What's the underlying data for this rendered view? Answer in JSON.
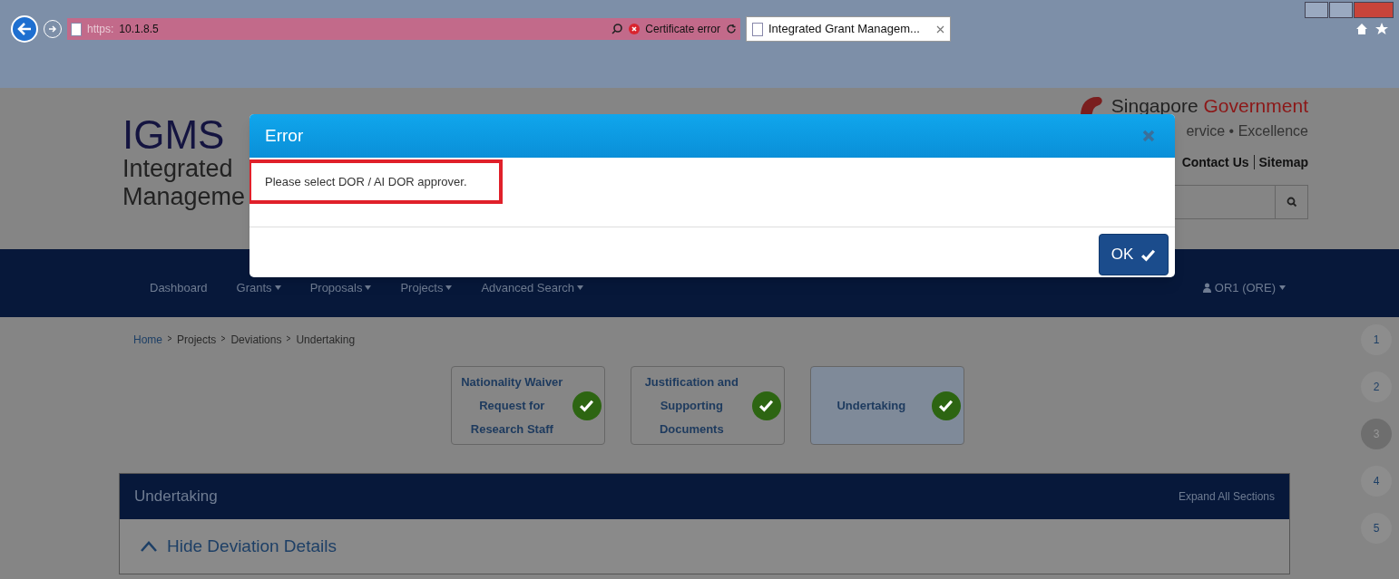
{
  "browser": {
    "url_scheme": "https:",
    "url_host": "10.1.8.5",
    "certificate": "Certificate error",
    "tab_title": "Integrated Grant Managem..."
  },
  "header": {
    "logo": "IGMS",
    "logo_line_1": "Integrated",
    "logo_line_2": "Manageme",
    "gov_1": "Singapore",
    "gov_2": "Government",
    "gov_tagline": "ervice • Excellence",
    "links": [
      "Contact Us",
      "Sitemap"
    ]
  },
  "nav": {
    "items": [
      {
        "label": "Dashboard",
        "dropdown": false
      },
      {
        "label": "Grants",
        "dropdown": true
      },
      {
        "label": "Proposals",
        "dropdown": true
      },
      {
        "label": "Projects",
        "dropdown": true
      },
      {
        "label": "Advanced Search",
        "dropdown": true
      }
    ],
    "user": "OR1 (ORE)"
  },
  "breadcrumb": [
    "Home",
    "Projects",
    "Deviations",
    "Undertaking"
  ],
  "steps": [
    {
      "label": "Nationality Waiver Request for Research Staff",
      "done": true,
      "selected": false
    },
    {
      "label": "Justification and Supporting Documents",
      "done": true,
      "selected": false
    },
    {
      "label": "Undertaking",
      "done": true,
      "selected": true
    }
  ],
  "side_steps": [
    {
      "label": "1",
      "selected": false
    },
    {
      "label": "2",
      "selected": false
    },
    {
      "label": "3",
      "selected": true
    },
    {
      "label": "4",
      "selected": false
    },
    {
      "label": "5",
      "selected": false
    }
  ],
  "panel": {
    "title": "Undertaking",
    "action": "Expand All Sections",
    "section": "Hide Deviation Details"
  },
  "dialog": {
    "title": "Error",
    "message": "Please select DOR / AI DOR approver.",
    "ok": "OK"
  }
}
